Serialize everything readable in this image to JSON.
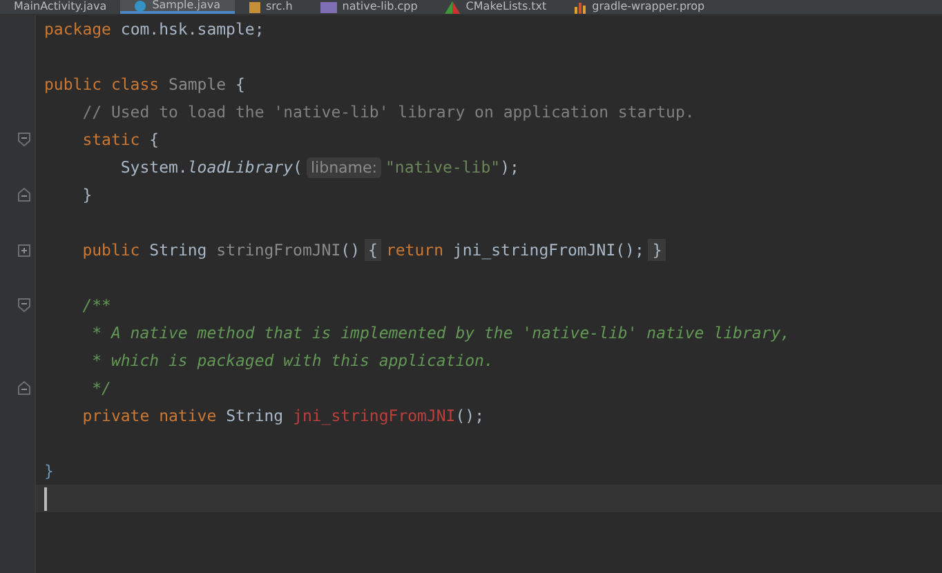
{
  "tabs": [
    {
      "label": "MainActivity.java",
      "selected": false
    },
    {
      "label": "Sample.java",
      "selected": true,
      "kind": "class"
    },
    {
      "label": "src.h",
      "selected": false,
      "kind": "header"
    },
    {
      "label": "native-lib.cpp",
      "selected": false,
      "kind": "cpp"
    },
    {
      "label": "CMakeLists.txt",
      "selected": false,
      "kind": "cmake"
    },
    {
      "label": "gradle-wrapper.prop",
      "selected": false,
      "kind": "gradle"
    }
  ],
  "lines": [
    {
      "current": false,
      "tokens": [
        {
          "kind": "keyword",
          "text": "package "
        },
        {
          "kind": "plain",
          "text": "com.hsk.sample;"
        }
      ]
    },
    {
      "current": false
    },
    {
      "current": false,
      "tokens": [
        {
          "kind": "keyword",
          "text": "public class "
        },
        {
          "kind": "unused",
          "text": "Sample "
        },
        {
          "kind": "plain",
          "text": "{"
        }
      ]
    },
    {
      "current": false,
      "tokens": [
        {
          "kind": "comment",
          "text": "    // Used to load the 'native-lib' library on application startup."
        }
      ]
    },
    {
      "kind": "fold-start",
      "current": false,
      "tokens": [
        {
          "kind": "keyword",
          "text": "    static "
        },
        {
          "kind": "plain",
          "text": "{"
        }
      ]
    },
    {
      "current": false,
      "tokens": [
        {
          "kind": "plain",
          "text": "        System."
        },
        {
          "kind": "static-call",
          "text": "loadLibrary"
        },
        {
          "kind": "plain",
          "text": "("
        },
        {
          "kind": "hint",
          "text": "libname:"
        },
        {
          "kind": "string",
          "text": "\"native-lib\""
        },
        {
          "kind": "plain",
          "text": ");"
        }
      ]
    },
    {
      "kind": "fold-end",
      "current": false,
      "tokens": [
        {
          "kind": "plain",
          "text": "    }"
        }
      ]
    },
    {
      "current": false
    },
    {
      "kind": "collapsed",
      "current": false,
      "tokens": [
        {
          "kind": "keyword",
          "text": "    public "
        },
        {
          "kind": "plain",
          "text": "String "
        },
        {
          "kind": "unused",
          "text": "stringFromJNI"
        },
        {
          "kind": "plain",
          "text": "()"
        },
        {
          "kind": "folded",
          "text": "{"
        },
        {
          "kind": "keyword",
          "text": "return "
        },
        {
          "kind": "plain",
          "text": "jni_stringFromJNI();"
        },
        {
          "kind": "folded",
          "text": "}"
        }
      ]
    },
    {
      "current": false
    },
    {
      "kind": "fold-start",
      "current": false,
      "tokens": [
        {
          "kind": "doc",
          "text": "    /**"
        }
      ]
    },
    {
      "current": false,
      "tokens": [
        {
          "kind": "doc",
          "text": "     * A native method that is implemented by the 'native-lib' native library,"
        }
      ]
    },
    {
      "current": false,
      "tokens": [
        {
          "kind": "doc",
          "text": "     * which is packaged with this application."
        }
      ]
    },
    {
      "kind": "fold-end",
      "current": false,
      "tokens": [
        {
          "kind": "doc",
          "text": "     */"
        }
      ]
    },
    {
      "current": false,
      "tokens": [
        {
          "kind": "keyword",
          "text": "    private native "
        },
        {
          "kind": "plain",
          "text": "String "
        },
        {
          "kind": "error",
          "text": "jni_stringFromJNI"
        },
        {
          "kind": "plain",
          "text": "();"
        }
      ]
    },
    {
      "current": false
    },
    {
      "current": false,
      "tokens": [
        {
          "kind": "brace",
          "text": "}"
        }
      ]
    },
    {
      "current": true
    }
  ]
}
